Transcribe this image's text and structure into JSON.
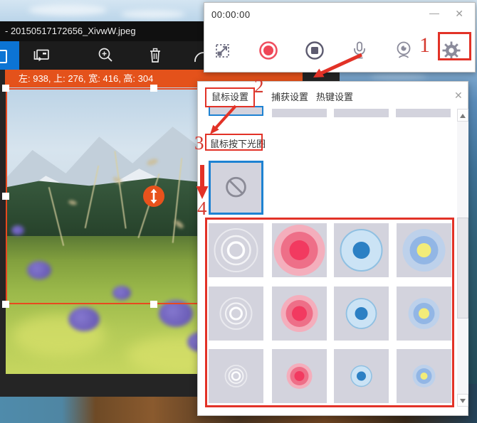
{
  "colors": {
    "annotation_red": "#e23227",
    "selection_orange": "#e8491f",
    "accent_blue": "#1e82d2",
    "record_red": "#ef4656",
    "info_bar_orange": "#e4521b"
  },
  "editor": {
    "title": "- 20150517172656_XivwW.jpeg",
    "info_bar": "左: 938, 上: 276, 宽: 416, 高: 304",
    "toolbar_icons": [
      "picture-in-picture",
      "zoom-in",
      "delete",
      "undo"
    ]
  },
  "recorder": {
    "timer": "00:00:00",
    "minimize_label": "—",
    "close_label": "✕",
    "buttons": [
      "resize-region",
      "record",
      "stop",
      "microphone",
      "webcam",
      "settings"
    ]
  },
  "settings_panel": {
    "tabs": [
      {
        "label": "鼠标设置"
      },
      {
        "label": "捕获设置"
      },
      {
        "label": "热键设置"
      }
    ],
    "close_label": "✕",
    "section_label": "鼠标按下光圈",
    "cell_bg": "#d3d3dd",
    "none_option": "no-halo",
    "halo_cells": [
      {
        "type": "white-rings",
        "circles": [
          {
            "r": 30,
            "stroke": "#ffffff",
            "sw": 2,
            "o": 0.5
          },
          {
            "r": 20,
            "stroke": "#ffffff",
            "sw": 2.5,
            "o": 0.7
          },
          {
            "r": 11,
            "stroke": "#ffffff",
            "sw": 3.5,
            "o": 0.95
          }
        ]
      },
      {
        "type": "red-halo",
        "circles": [
          {
            "r": 36,
            "fill": "#f4aebc"
          },
          {
            "r": 26,
            "fill": "#ee6f88"
          },
          {
            "r": 14,
            "fill": "#f23a60"
          }
        ]
      },
      {
        "type": "blue-dot",
        "circles": [
          {
            "r": 29,
            "fill": "#cbe3f5",
            "stroke": "#8fc0e2",
            "sw": 2
          },
          {
            "r": 12,
            "fill": "#2c80c4"
          }
        ]
      },
      {
        "type": "blue-yellow",
        "circles": [
          {
            "r": 30,
            "fill": "#bdd1eb"
          },
          {
            "r": 20,
            "fill": "#92b6e5"
          },
          {
            "r": 10,
            "fill": "#f3ec79"
          }
        ]
      },
      {
        "type": "white-rings",
        "circles": [
          {
            "r": 22,
            "stroke": "#ffffff",
            "sw": 2,
            "o": 0.5
          },
          {
            "r": 14.5,
            "stroke": "#ffffff",
            "sw": 2.2,
            "o": 0.7
          },
          {
            "r": 8,
            "stroke": "#ffffff",
            "sw": 3,
            "o": 0.95
          }
        ]
      },
      {
        "type": "red-halo",
        "circles": [
          {
            "r": 26,
            "fill": "#f4aebc"
          },
          {
            "r": 19,
            "fill": "#ee6f88"
          },
          {
            "r": 10.5,
            "fill": "#f23a60"
          }
        ]
      },
      {
        "type": "blue-dot",
        "circles": [
          {
            "r": 21,
            "fill": "#cbe3f5",
            "stroke": "#8fc0e2",
            "sw": 1.8
          },
          {
            "r": 9,
            "fill": "#2c80c4"
          }
        ]
      },
      {
        "type": "blue-yellow",
        "circles": [
          {
            "r": 22,
            "fill": "#bdd1eb"
          },
          {
            "r": 15,
            "fill": "#92b6e5"
          },
          {
            "r": 7.5,
            "fill": "#f3ec79"
          }
        ]
      },
      {
        "type": "white-rings",
        "circles": [
          {
            "r": 15,
            "stroke": "#ffffff",
            "sw": 1.8,
            "o": 0.5
          },
          {
            "r": 10,
            "stroke": "#ffffff",
            "sw": 2,
            "o": 0.7
          },
          {
            "r": 5.5,
            "stroke": "#ffffff",
            "sw": 2.5,
            "o": 0.95
          }
        ]
      },
      {
        "type": "red-halo",
        "circles": [
          {
            "r": 18,
            "fill": "#f4aebc"
          },
          {
            "r": 13,
            "fill": "#ee6f88"
          },
          {
            "r": 7,
            "fill": "#f23a60"
          }
        ]
      },
      {
        "type": "blue-dot",
        "circles": [
          {
            "r": 14.5,
            "fill": "#cbe3f5",
            "stroke": "#8fc0e2",
            "sw": 1.5
          },
          {
            "r": 6.5,
            "fill": "#2c80c4"
          }
        ]
      },
      {
        "type": "blue-yellow",
        "circles": [
          {
            "r": 16,
            "fill": "#bdd1eb"
          },
          {
            "r": 11,
            "fill": "#92b6e5"
          },
          {
            "r": 5,
            "fill": "#f3ec79"
          }
        ]
      }
    ]
  },
  "annotations": {
    "steps": [
      "1",
      "2",
      "3",
      "4"
    ]
  }
}
